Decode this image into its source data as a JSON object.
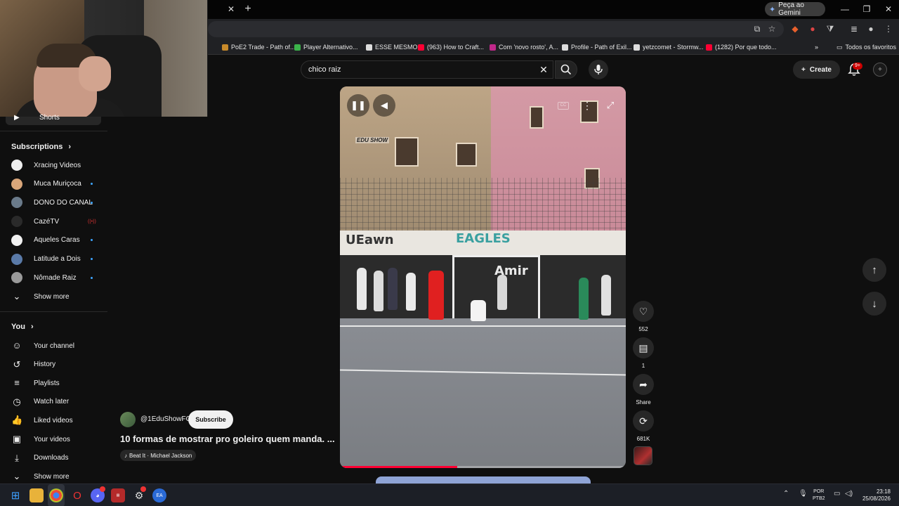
{
  "browser": {
    "gemini_label": "Peça ao Gemini",
    "bookmarks": [
      {
        "label": "PoE2 Trade - Path of...",
        "color": "#c88a2a"
      },
      {
        "label": "Player Alternativo...",
        "color": "#3bb34a"
      },
      {
        "label": "ESSE MESMO",
        "color": "#dddddd"
      },
      {
        "label": "(963) How to Craft...",
        "color": "#ff0033"
      },
      {
        "label": "Com 'novo rosto', A...",
        "color": "#c0288a"
      },
      {
        "label": "Profile - Path of Exil...",
        "color": "#dddddd"
      },
      {
        "label": "yetzcomet - Stormw...",
        "color": "#dddddd"
      },
      {
        "label": "(1282) Por que todo...",
        "color": "#ff0033"
      }
    ],
    "all_bookmarks_label": "Todos os favoritos"
  },
  "sidebar": {
    "shorts_label": "Shorts",
    "subscriptions_heading": "Subscriptions",
    "subscriptions": [
      {
        "label": "Xracing Videos",
        "avatar_color": "#eeeeee",
        "indicator": "none"
      },
      {
        "label": "Muca Muriçoca",
        "avatar_color": "#d9a67a",
        "indicator": "dot"
      },
      {
        "label": "DONO DO CANAL",
        "avatar_color": "#6a7a8a",
        "indicator": "dot"
      },
      {
        "label": "CazéTV",
        "avatar_color": "#2a2a2a",
        "indicator": "live"
      },
      {
        "label": "Aqueles Caras",
        "avatar_color": "#f1f1f1",
        "indicator": "dot"
      },
      {
        "label": "Latitude a Dois",
        "avatar_color": "#5a7aa8",
        "indicator": "dot"
      },
      {
        "label": "Nômade Raiz",
        "avatar_color": "#9a9a9a",
        "indicator": "dot"
      }
    ],
    "show_more_label": "Show more",
    "you_heading": "You",
    "you_items": [
      {
        "label": "Your channel",
        "icon": "channel-icon",
        "glyph": "☺"
      },
      {
        "label": "History",
        "icon": "history-icon",
        "glyph": "↺"
      },
      {
        "label": "Playlists",
        "icon": "playlists-icon",
        "glyph": "≡"
      },
      {
        "label": "Watch later",
        "icon": "clock-icon",
        "glyph": "◷"
      },
      {
        "label": "Liked videos",
        "icon": "thumbs-up-icon",
        "glyph": "👍"
      },
      {
        "label": "Your videos",
        "icon": "your-videos-icon",
        "glyph": "▣"
      },
      {
        "label": "Downloads",
        "icon": "download-icon",
        "glyph": "⤓"
      }
    ],
    "show_more_bottom_label": "Show more"
  },
  "search": {
    "query": "chico raiz"
  },
  "header": {
    "create_label": "Create",
    "notifications_badge": "9+"
  },
  "video": {
    "channel_handle": "@1EduShowFC",
    "subscribe_label": "Subscribe",
    "title": "10 formas de mostrar pro goleiro quem manda. ...",
    "music": "Beat It · Michael Jackson",
    "watermark": "EDU SHOW",
    "progress_fraction": 0.41
  },
  "actions": {
    "likes": "552",
    "comments": "1",
    "share_label": "Share",
    "remix_count": "681K"
  },
  "taskbar": {
    "lang_line1": "POR",
    "lang_line2": "PTB2",
    "time": "23:18",
    "date": "25/08/2026"
  },
  "colors": {
    "accent_red": "#ff0033",
    "background": "#0f0f0f",
    "chip": "#272727"
  }
}
